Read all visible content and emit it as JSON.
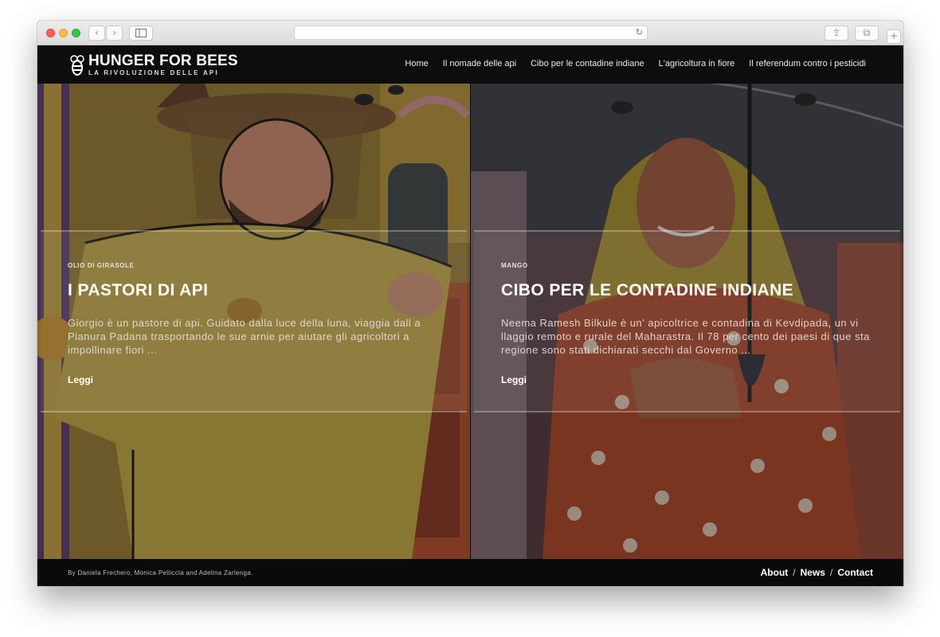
{
  "browser": {
    "controls": [
      "close",
      "minimize",
      "zoom"
    ],
    "back_glyph": "‹",
    "forward_glyph": "›",
    "reload_glyph": "↻",
    "share_glyph": "⇪",
    "tabs_glyph": "⧉",
    "new_tab_glyph": "+"
  },
  "header": {
    "logo_title": "HUNGER FOR BEES",
    "logo_subtitle": "LA RIVOLUZIONE DELLE API",
    "nav": [
      {
        "label": "Home"
      },
      {
        "label": "Il nomade delle api"
      },
      {
        "label": "Cibo per le contadine indiane"
      },
      {
        "label": "L'agricoltura in fiore"
      },
      {
        "label": "Il referendum contro i pesticidi"
      }
    ]
  },
  "stories": [
    {
      "category": "OLIO DI GIRASOLE",
      "title": "I PASTORI DI API",
      "excerpt": "Giorgio è un pastore di api. Guidato dalla luce della luna, viaggia dall a Pianura Padana trasportando le sue arnie per aiutare gli agricoltori a impollinare fiori ...",
      "read_more": "Leggi"
    },
    {
      "category": "MANGO",
      "title": "CIBO PER LE CONTADINE INDIANE",
      "excerpt": "Neema Ramesh Bilkule è un' apicoltrice e contadina di Kevdipada, un vi llaggio remoto e rurale del Maharastra. Il 78 per cento dei paesi di que sta regione sono stati dichiarati secchi dal Governo ...",
      "read_more": "Leggi"
    }
  ],
  "footer": {
    "credits": "By Daniela Frechero, Monica Pelliccia and Adelina Zarlenga.",
    "links": [
      {
        "label": "About"
      },
      {
        "label": "News"
      },
      {
        "label": "Contact"
      }
    ],
    "separator": "/"
  },
  "colors": {
    "header_bg": "#0d0d0d",
    "left_art_main": "#b89a45",
    "right_art_main": "#b5472e"
  }
}
